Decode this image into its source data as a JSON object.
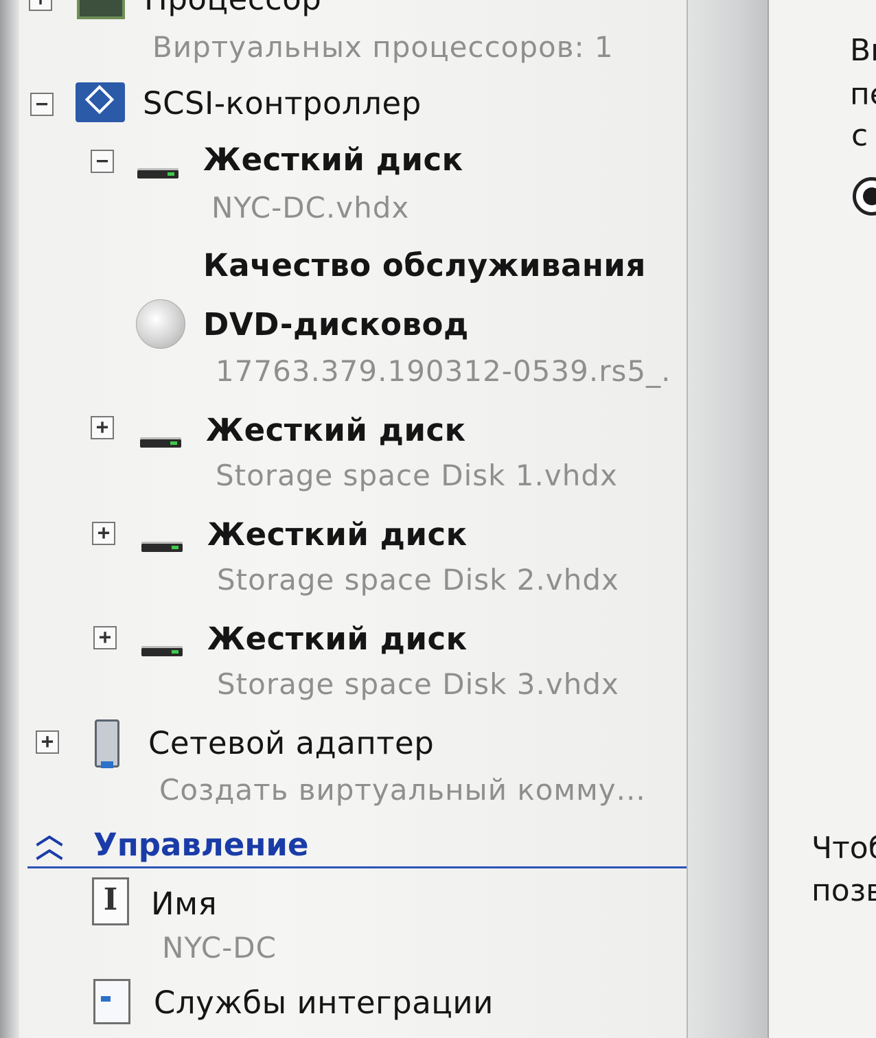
{
  "hardware": {
    "processor": {
      "label": "Процессор",
      "detail": "Виртуальных процессоров: 1"
    },
    "scsi": {
      "label": "SCSI-контроллер"
    },
    "disk0": {
      "label": "Жесткий диск",
      "file": "NYC-DC.vhdx",
      "qos": "Качество обслуживания"
    },
    "dvd": {
      "label": "DVD-дисковод",
      "file": "17763.379.190312-0539.rs5_."
    },
    "disk1": {
      "label": "Жесткий диск",
      "file": "Storage space Disk 1.vhdx"
    },
    "disk2": {
      "label": "Жесткий диск",
      "file": "Storage space Disk 2.vhdx"
    },
    "disk3": {
      "label": "Жесткий диск",
      "file": "Storage space Disk 3.vhdx"
    },
    "network": {
      "label": "Сетевой адаптер",
      "detail": "Создать виртуальный комму..."
    }
  },
  "management": {
    "header": "Управление",
    "name": {
      "label": "Имя",
      "value": "NYC-DC"
    },
    "integration": {
      "label": "Службы интеграции"
    }
  },
  "right_pane": {
    "line1": "Вь",
    "line2": "пе",
    "line3": "с",
    "line4": "Чтоб",
    "line5": "позв"
  },
  "colors": {
    "section_header": "#1a3ca8",
    "sub_text": "#8f8f8f",
    "disk_led": "#3ecb4a"
  },
  "icons": {
    "expand": "+",
    "collapse": "−",
    "collapse_section": "double-chevron-up-icon"
  }
}
